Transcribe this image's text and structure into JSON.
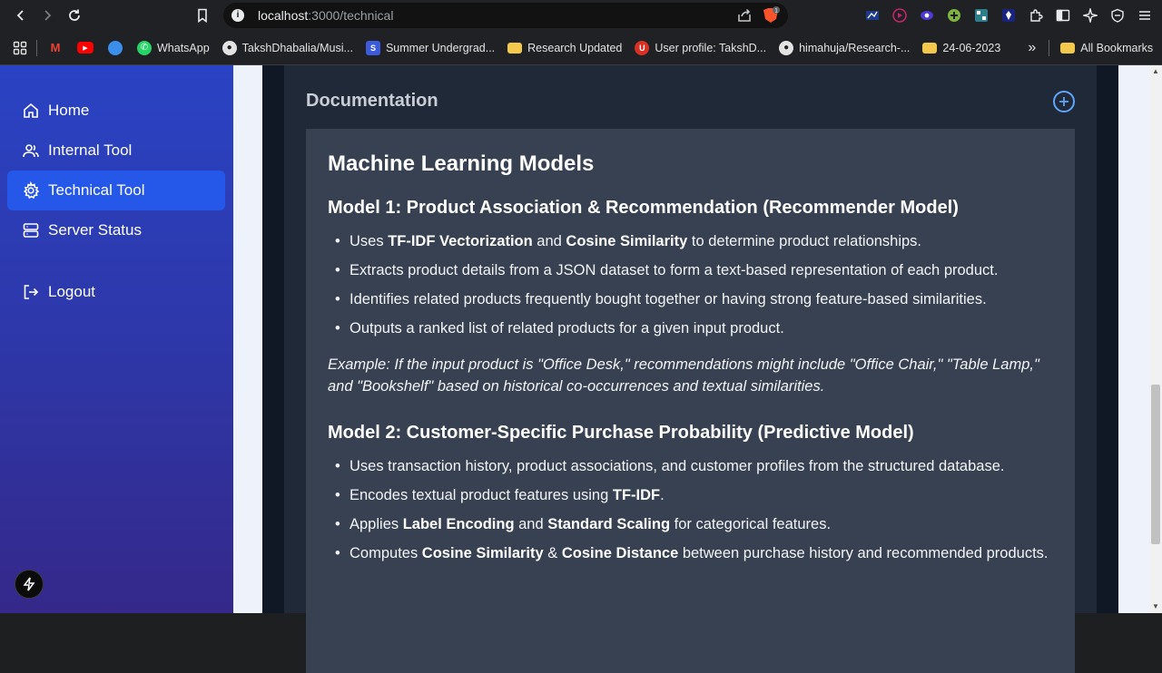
{
  "browser": {
    "url_host": "localhost",
    "url_path": ":3000/technical",
    "brave_badge": "1",
    "bookmarks": [
      {
        "label": "",
        "color": "#4285f4",
        "glyph": "M"
      },
      {
        "label": "",
        "color": "#ff0000",
        "glyph": "▶"
      },
      {
        "label": "",
        "color": "#1a73e8",
        "glyph": "◐"
      },
      {
        "label": "WhatsApp",
        "color": "#25d366",
        "glyph": "✆"
      },
      {
        "label": "TakshDhabalia/Musi...",
        "color": "#e3e3e3",
        "glyph": "●"
      },
      {
        "label": "Summer Undergrad...",
        "color": "#3b5bdb",
        "glyph": "S"
      },
      {
        "label": "Research Updated",
        "color": "#f2c94c",
        "glyph": "▆"
      },
      {
        "label": "User profile: TakshD...",
        "color": "#d93025",
        "glyph": "U"
      },
      {
        "label": "himahuja/Research-...",
        "color": "#e3e3e3",
        "glyph": "●"
      },
      {
        "label": "24-06-2023",
        "color": "#f2c94c",
        "glyph": "▆"
      }
    ],
    "overflow_label": "»",
    "all_bookmarks_label": "All Bookmarks"
  },
  "sidebar": {
    "items": [
      {
        "label": "Home",
        "icon": "home-icon"
      },
      {
        "label": "Internal Tool",
        "icon": "users-icon"
      },
      {
        "label": "Technical Tool",
        "icon": "gear-icon",
        "active": true
      },
      {
        "label": "Server Status",
        "icon": "server-icon"
      },
      {
        "label": "Logout",
        "icon": "logout-icon"
      }
    ]
  },
  "doc": {
    "section_title": "Documentation",
    "heading": "Machine Learning Models",
    "model1": {
      "title": "Model 1: Product Association & Recommendation (Recommender Model)",
      "b1_pre": "Uses ",
      "b1_bold1": "TF-IDF Vectorization",
      "b1_mid": " and ",
      "b1_bold2": "Cosine Similarity",
      "b1_post": " to determine product relationships.",
      "b2": "Extracts product details from a JSON dataset to form a text-based representation of each product.",
      "b3": "Identifies related products frequently bought together or having strong feature-based similarities.",
      "b4": "Outputs a ranked list of related products for a given input product.",
      "example": "Example: If the input product is \"Office Desk,\" recommendations might include \"Office Chair,\" \"Table Lamp,\" and \"Bookshelf\" based on historical co-occurrences and textual similarities."
    },
    "model2": {
      "title": "Model 2: Customer-Specific Purchase Probability (Predictive Model)",
      "b1": "Uses transaction history, product associations, and customer profiles from the structured database.",
      "b2_pre": "Encodes textual product features using ",
      "b2_bold": "TF-IDF",
      "b2_post": ".",
      "b3_pre": "Applies ",
      "b3_bold1": "Label Encoding",
      "b3_mid": " and ",
      "b3_bold2": "Standard Scaling",
      "b3_post": " for categorical features.",
      "b4_pre": "Computes ",
      "b4_bold1": "Cosine Similarity",
      "b4_mid": " & ",
      "b4_bold2": "Cosine Distance",
      "b4_post": " between purchase history and recommended products."
    }
  }
}
